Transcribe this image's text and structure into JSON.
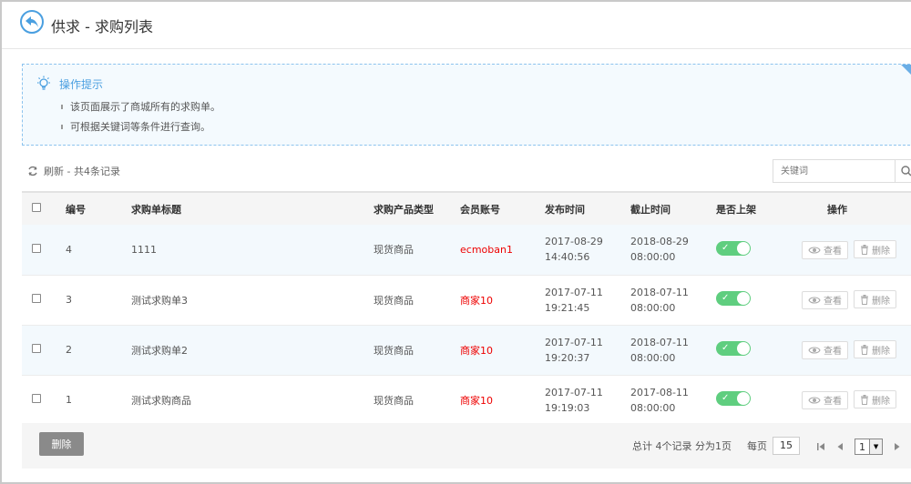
{
  "header": {
    "title": "供求 - 求购列表"
  },
  "tips": {
    "title": "操作提示",
    "items": [
      "该页面展示了商城所有的求购单。",
      "可根据关键词等条件进行查询。"
    ]
  },
  "toolbar": {
    "refresh_label": "刷新 - 共4条记录"
  },
  "search": {
    "placeholder": "关键词"
  },
  "table": {
    "headers": [
      "编号",
      "求购单标题",
      "求购产品类型",
      "会员账号",
      "发布时间",
      "截止时间",
      "是否上架",
      "操作"
    ],
    "rows": [
      {
        "id": "4",
        "title": "1111",
        "type": "现货商品",
        "account": "ecmoban1",
        "publish_date": "2017-08-29",
        "publish_time": "14:40:56",
        "end_date": "2018-08-29",
        "end_time": "08:00:00",
        "on_shelf": true,
        "view": "查看",
        "delete": "删除"
      },
      {
        "id": "3",
        "title": "测试求购单3",
        "type": "现货商品",
        "account": "商家10",
        "publish_date": "2017-07-11",
        "publish_time": "19:21:45",
        "end_date": "2018-07-11",
        "end_time": "08:00:00",
        "on_shelf": true,
        "view": "查看",
        "delete": "删除"
      },
      {
        "id": "2",
        "title": "测试求购单2",
        "type": "现货商品",
        "account": "商家10",
        "publish_date": "2017-07-11",
        "publish_time": "19:20:37",
        "end_date": "2018-07-11",
        "end_time": "08:00:00",
        "on_shelf": true,
        "view": "查看",
        "delete": "删除"
      },
      {
        "id": "1",
        "title": "测试求购商品",
        "type": "现货商品",
        "account": "商家10",
        "publish_date": "2017-07-11",
        "publish_time": "19:19:03",
        "end_date": "2017-08-11",
        "end_time": "08:00:00",
        "on_shelf": true,
        "view": "查看",
        "delete": "删除"
      }
    ]
  },
  "footer": {
    "delete_label": "删除",
    "summary": "总计 4个记录 分为1页",
    "per_page_label": "每页",
    "per_page_value": "15",
    "current_page": "1"
  },
  "colors": {
    "accent": "#4a9fe0",
    "toggle_on": "#5fce7f",
    "account_red": "#ee0000"
  }
}
